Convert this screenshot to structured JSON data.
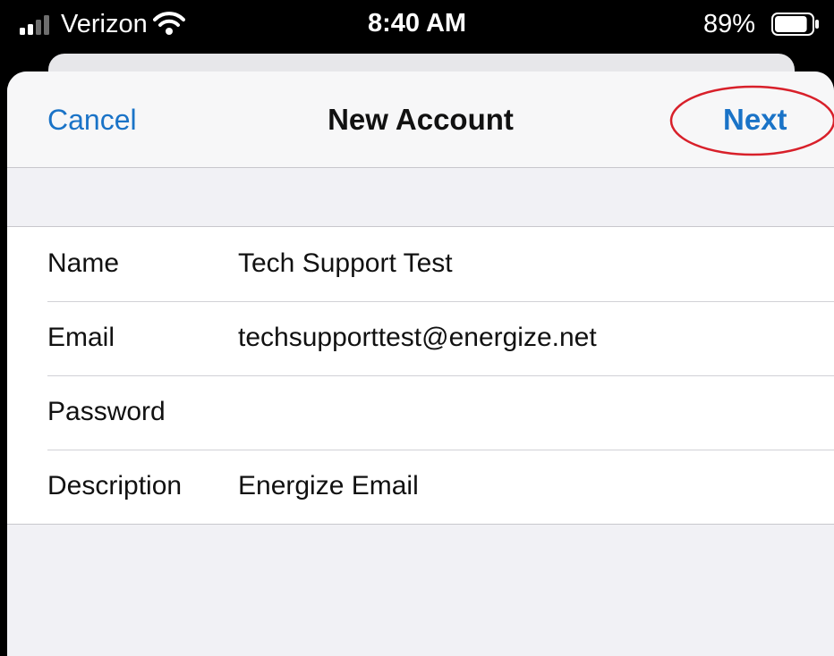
{
  "status_bar": {
    "carrier": "Verizon",
    "time": "8:40 AM",
    "battery_percent": "89%",
    "battery_level": 0.89,
    "icons": [
      "cellular-signal-icon",
      "wifi-icon",
      "battery-icon"
    ]
  },
  "nav": {
    "cancel_label": "Cancel",
    "title": "New Account",
    "next_label": "Next",
    "highlight_color": "#d8202a"
  },
  "form": {
    "rows": [
      {
        "label": "Name",
        "value": "Tech Support Test"
      },
      {
        "label": "Email",
        "value": "techsupporttest@energize.net"
      },
      {
        "label": "Password",
        "value": ""
      },
      {
        "label": "Description",
        "value": "Energize Email"
      }
    ]
  },
  "colors": {
    "accent": "#1a73c7",
    "sheet_background": "#f1f1f5",
    "form_background": "#ffffff"
  }
}
